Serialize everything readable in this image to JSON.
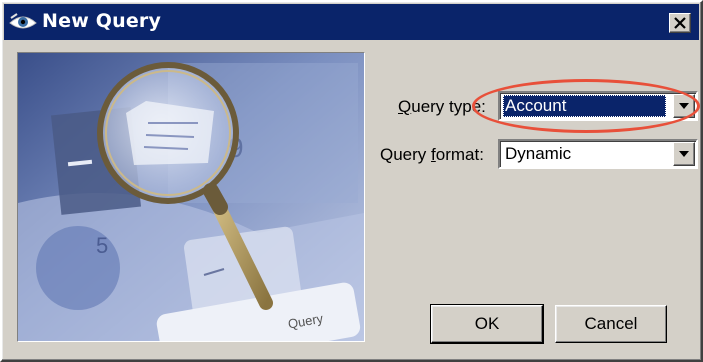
{
  "window": {
    "title": "New Query",
    "close_glyph": "✕"
  },
  "illustration": {
    "keycap_text": "Query",
    "digits": [
      "9",
      "5"
    ]
  },
  "form": {
    "query_type": {
      "label_accel": "Q",
      "label_rest": "uery type:",
      "value": "Account"
    },
    "query_format": {
      "label_pre": "Query ",
      "label_accel": "f",
      "label_post": "ormat:",
      "value": "Dynamic"
    }
  },
  "buttons": {
    "ok": "OK",
    "cancel": "Cancel"
  },
  "colors": {
    "titlebar": "#0a246a",
    "dialog_face": "#d4d0c8",
    "selection": "#0a246a",
    "annotation": "#e8503a"
  }
}
